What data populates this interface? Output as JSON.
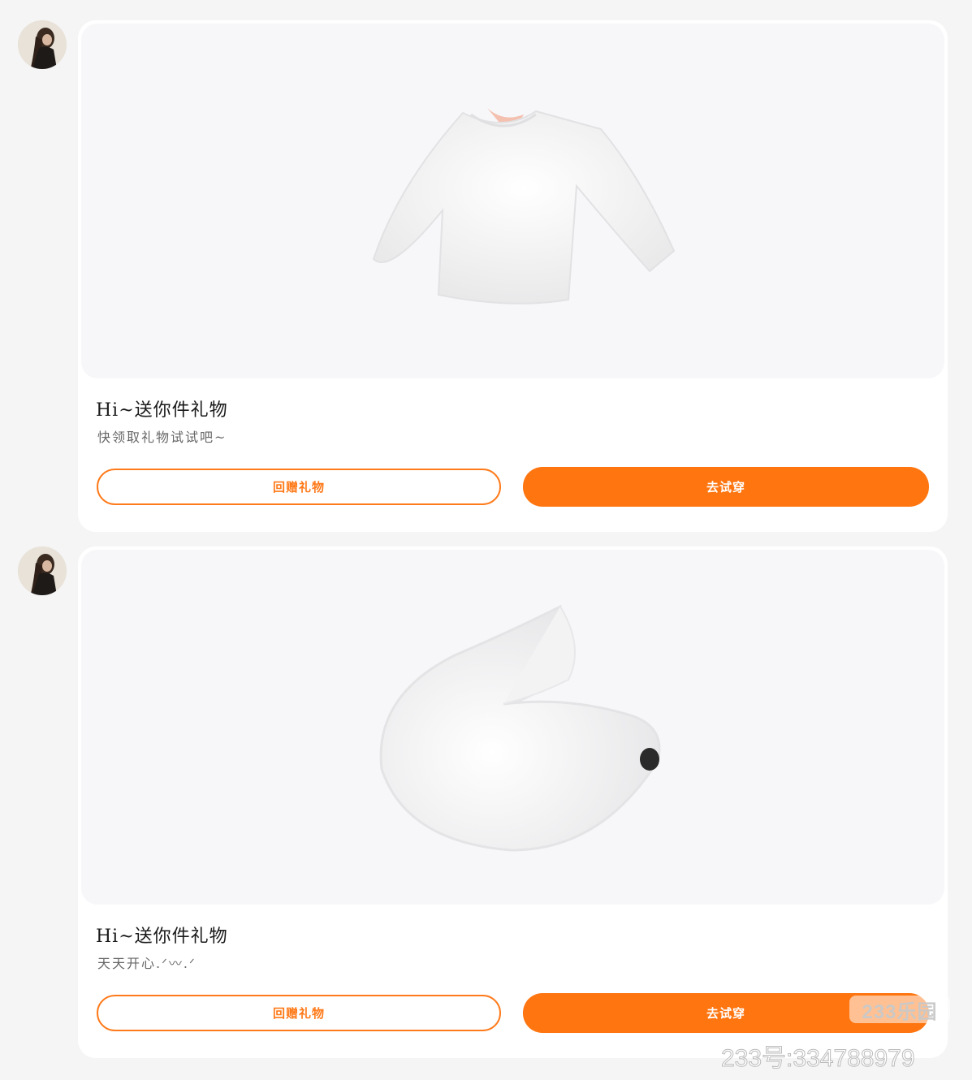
{
  "messages": [
    {
      "title": "Hi~送你件礼物",
      "subtitle": "快领取礼物试试吧~",
      "image": "white-sweater-image",
      "return_gift_label": "回赠礼物",
      "try_on_label": "去试穿"
    },
    {
      "title": "Hi~送你件礼物",
      "subtitle": "天天开心.ᐟ〰.ᐟ",
      "image": "white-fox-tail-image",
      "return_gift_label": "回赠礼物",
      "try_on_label": "去试穿"
    }
  ],
  "watermark": {
    "logo": "233乐园",
    "id": "233号:334788979"
  },
  "colors": {
    "accent": "#ff7510",
    "page_bg": "#f5f5f6",
    "card_bg": "#ffffff"
  }
}
